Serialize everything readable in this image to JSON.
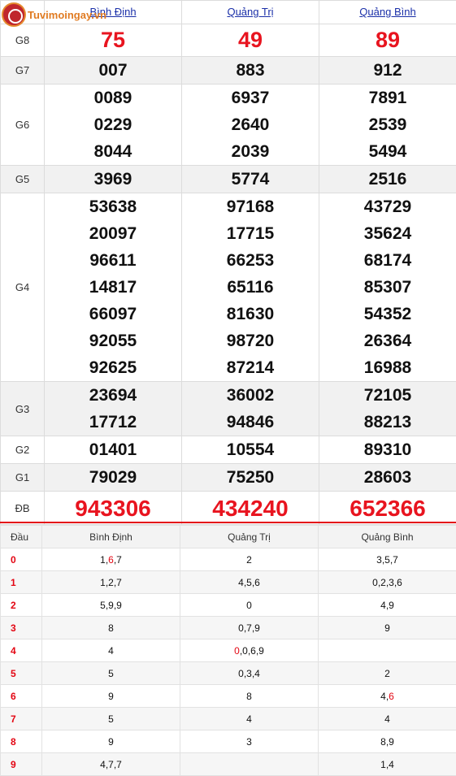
{
  "logo": {
    "text": "Tuvimoingay.vn"
  },
  "provinces": [
    "Bình Định",
    "Quảng Trị",
    "Quảng Bình"
  ],
  "prizes": {
    "g8": {
      "label": "G8",
      "values": [
        "75",
        "49",
        "89"
      ]
    },
    "g7": {
      "label": "G7",
      "values": [
        "007",
        "883",
        "912"
      ]
    },
    "g6": {
      "label": "G6",
      "values": [
        [
          "0089",
          "0229",
          "8044"
        ],
        [
          "6937",
          "2640",
          "2039"
        ],
        [
          "7891",
          "2539",
          "5494"
        ]
      ]
    },
    "g5": {
      "label": "G5",
      "values": [
        "3969",
        "5774",
        "2516"
      ]
    },
    "g4": {
      "label": "G4",
      "values": [
        [
          "53638",
          "20097",
          "96611",
          "14817",
          "66097",
          "92055",
          "92625"
        ],
        [
          "97168",
          "17715",
          "66253",
          "65116",
          "81630",
          "98720",
          "87214"
        ],
        [
          "43729",
          "35624",
          "68174",
          "85307",
          "54352",
          "26364",
          "16988"
        ]
      ]
    },
    "g3": {
      "label": "G3",
      "values": [
        [
          "23694",
          "17712"
        ],
        [
          "36002",
          "94846"
        ],
        [
          "72105",
          "88213"
        ]
      ]
    },
    "g2": {
      "label": "G2",
      "values": [
        "01401",
        "10554",
        "89310"
      ]
    },
    "g1": {
      "label": "G1",
      "values": [
        "79029",
        "75250",
        "28603"
      ]
    },
    "db": {
      "label": "ĐB",
      "values": [
        "943306",
        "434240",
        "652366"
      ]
    }
  },
  "dau_table": {
    "header": [
      "Đầu",
      "Bình Định",
      "Quảng Trị",
      "Quảng Bình"
    ],
    "rows": [
      {
        "head": "0",
        "cols": [
          [
            "1,",
            "6",
            ",7"
          ],
          [
            "2",
            "",
            ""
          ],
          [
            "3,5,7",
            "",
            ""
          ]
        ]
      },
      {
        "head": "1",
        "cols": [
          [
            "1,2,7",
            "",
            ""
          ],
          [
            "4,5,6",
            "",
            ""
          ],
          [
            "0,2,3,6",
            "",
            ""
          ]
        ]
      },
      {
        "head": "2",
        "cols": [
          [
            "5,9,9",
            "",
            ""
          ],
          [
            "0",
            "",
            ""
          ],
          [
            "4,9",
            "",
            ""
          ]
        ]
      },
      {
        "head": "3",
        "cols": [
          [
            "8",
            "",
            ""
          ],
          [
            "0,7,9",
            "",
            ""
          ],
          [
            "9",
            "",
            ""
          ]
        ]
      },
      {
        "head": "4",
        "cols": [
          [
            "4",
            "",
            ""
          ],
          [
            "",
            "0",
            ",0,6,9"
          ],
          [
            "",
            "",
            ""
          ]
        ]
      },
      {
        "head": "5",
        "cols": [
          [
            "5",
            "",
            ""
          ],
          [
            "0,3,4",
            "",
            ""
          ],
          [
            "2",
            "",
            ""
          ]
        ]
      },
      {
        "head": "6",
        "cols": [
          [
            "9",
            "",
            ""
          ],
          [
            "8",
            "",
            ""
          ],
          [
            "4,",
            "6",
            ""
          ]
        ]
      },
      {
        "head": "7",
        "cols": [
          [
            "5",
            "",
            ""
          ],
          [
            "4",
            "",
            ""
          ],
          [
            "4",
            "",
            ""
          ]
        ]
      },
      {
        "head": "8",
        "cols": [
          [
            "9",
            "",
            ""
          ],
          [
            "3",
            "",
            ""
          ],
          [
            "8,9",
            "",
            ""
          ]
        ]
      },
      {
        "head": "9",
        "cols": [
          [
            "4,7,7",
            "",
            ""
          ],
          [
            "",
            "",
            ""
          ],
          [
            "1,4",
            "",
            ""
          ]
        ]
      }
    ]
  },
  "colors": {
    "accent_red": "#e30613",
    "link_blue": "#1a2fa8",
    "logo_orange": "#e07b22"
  }
}
